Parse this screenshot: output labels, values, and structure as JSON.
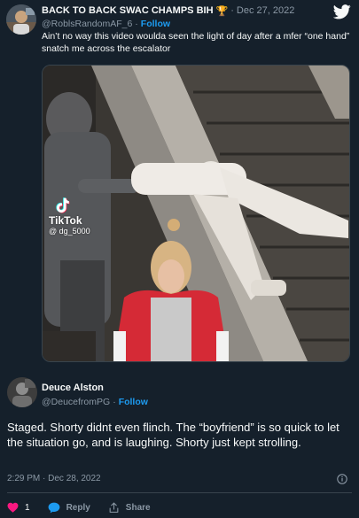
{
  "quoted_tweet": {
    "author": {
      "display_name": "BACK TO BACK SWAC CHAMPS BIH",
      "badge_emoji": "🏆",
      "handle": "@RoblsRandomAF_6"
    },
    "date": "Dec 27, 2022",
    "separator": "·",
    "follow_label": "Follow",
    "text": "Ain’t no way this video woulda seen the light of day after a mfer “one hand” snatch me across the escalator",
    "media": {
      "watermark_name": "TikTok",
      "watermark_user": "@ dg_5000"
    }
  },
  "reply_tweet": {
    "author": {
      "display_name": "Deuce Alston",
      "handle": "@DeucefromPG"
    },
    "separator": "·",
    "follow_label": "Follow",
    "text": "Staged. Shorty didnt even flinch. The “boyfriend” is so quick to let the situation go, and is laughing. Shorty just kept strolling.",
    "timestamp": "2:29 PM · Dec 28, 2022",
    "actions": {
      "like_count": "1",
      "reply_label": "Reply",
      "share_label": "Share"
    }
  },
  "colors": {
    "background": "#15202b",
    "accent": "#1d9bf0",
    "like": "#f91880",
    "muted": "#8b98a5"
  }
}
